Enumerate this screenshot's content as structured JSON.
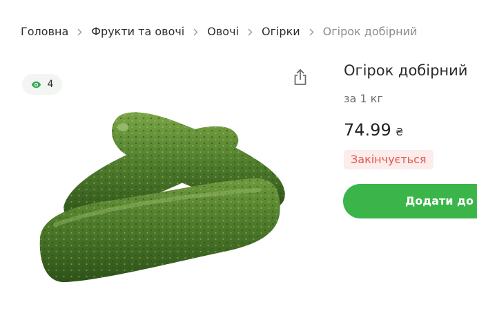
{
  "breadcrumb": [
    {
      "label": "Головна"
    },
    {
      "label": "Фрукти та овочі"
    },
    {
      "label": "Овочі"
    },
    {
      "label": "Огірки"
    },
    {
      "label": "Огірок добірний"
    }
  ],
  "views": {
    "count": "4",
    "icon": "eye-icon"
  },
  "share": {
    "icon": "share-icon"
  },
  "product": {
    "title": "Огірок добірний",
    "unit": "за 1 кг",
    "price": "74.99",
    "currency": "₴",
    "stock_status": "Закінчується",
    "add_button": "Додати до к"
  },
  "colors": {
    "accent_green": "#3bb54a",
    "status_red": "#e2574c",
    "status_bg": "#fdecec"
  }
}
